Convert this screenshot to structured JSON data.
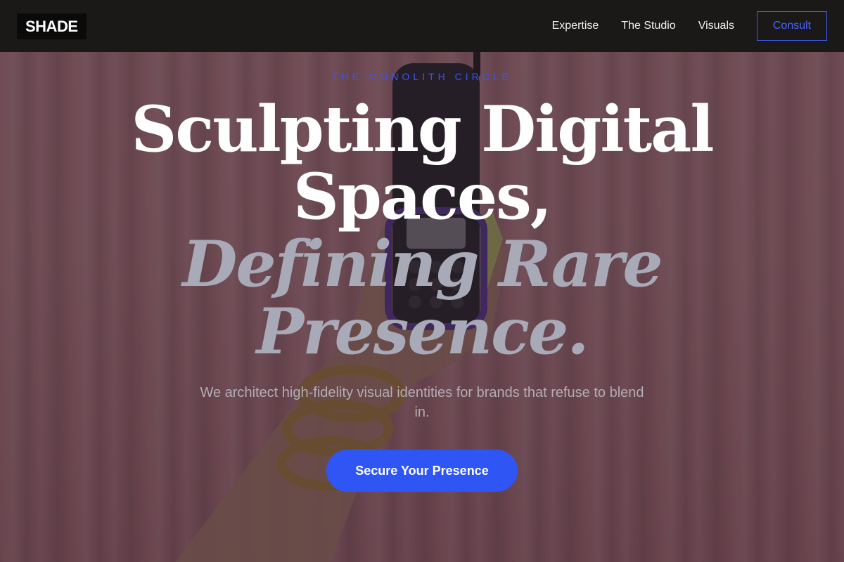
{
  "nav": {
    "logo": "SHADE",
    "links": [
      "Expertise",
      "The Studio",
      "Visuals"
    ],
    "cta": "Consult"
  },
  "hero": {
    "eyebrow": "THE MONOLITH CIRCLE",
    "headline": {
      "line1": "Sculpting Digital",
      "line2": "Spaces,",
      "line3": "Defining Rare",
      "line4": "Presence."
    },
    "subtitle": "We architect high-fidelity visual identities for brands that refuse to blend in.",
    "cta": "Secure Your Presence"
  },
  "colors": {
    "accent": "#2f56f5",
    "nav_bg": "#1b1818",
    "eyebrow": "#3a55f0",
    "headline_primary": "#ffffff",
    "headline_secondary": "#a9aab7"
  },
  "icons": {
    "background": "hand-holding-phone-image"
  }
}
